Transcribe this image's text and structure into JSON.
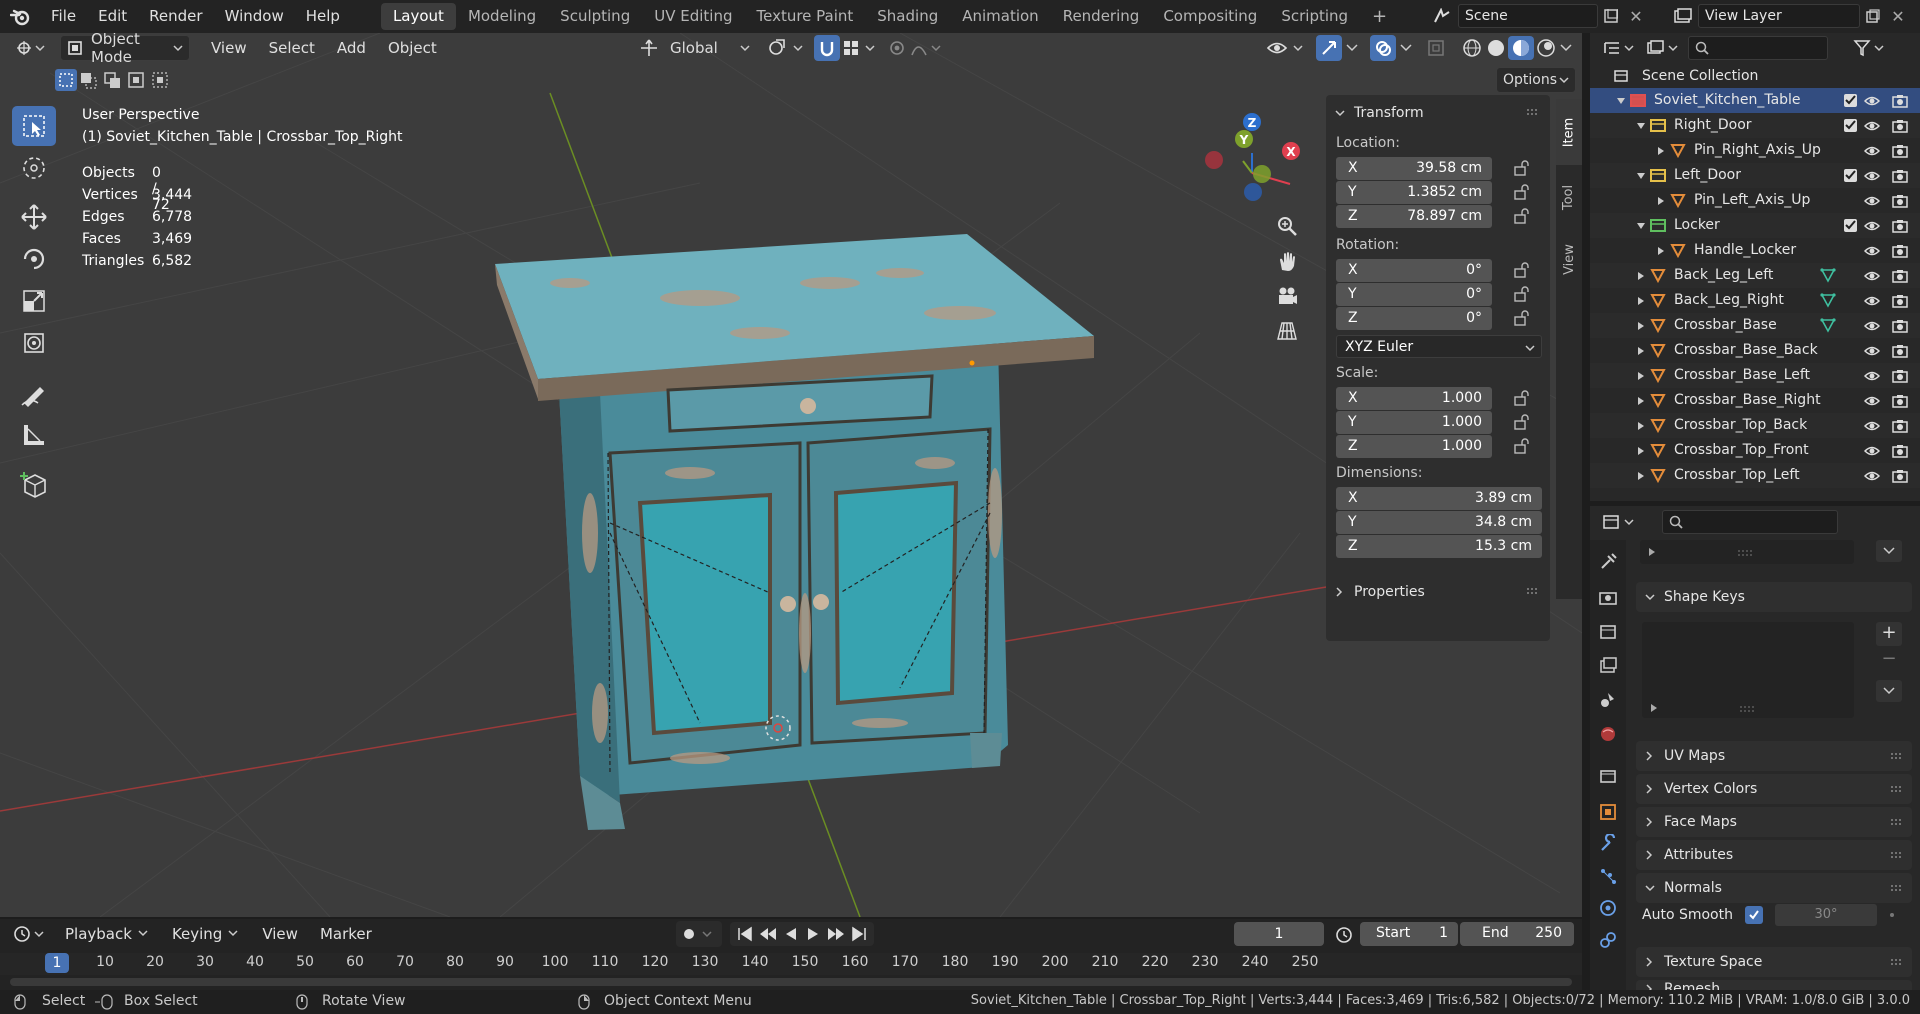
{
  "topbar": {
    "menus": [
      "File",
      "Edit",
      "Render",
      "Window",
      "Help"
    ],
    "workspaces": [
      "Layout",
      "Modeling",
      "Sculpting",
      "UV Editing",
      "Texture Paint",
      "Shading",
      "Animation",
      "Rendering",
      "Compositing",
      "Scripting"
    ],
    "add_tab": "+",
    "scene": "Scene",
    "view_layer": "View Layer"
  },
  "viewport": {
    "mode": "Object Mode",
    "menus": [
      "View",
      "Select",
      "Add",
      "Object"
    ],
    "transform_orientation": "Global",
    "options": "Options",
    "overlay_title": "User Perspective",
    "overlay_subtitle": "(1) Soviet_Kitchen_Table | Crossbar_Top_Right",
    "stats": [
      {
        "label": "Objects",
        "value": "0 / 72"
      },
      {
        "label": "Vertices",
        "value": "3,444"
      },
      {
        "label": "Edges",
        "value": "6,778"
      },
      {
        "label": "Faces",
        "value": "3,469"
      },
      {
        "label": "Triangles",
        "value": "6,582"
      }
    ],
    "gizmo": {
      "x": "X",
      "y": "Y",
      "z": "Z"
    },
    "side_tabs": [
      "Item",
      "Tool",
      "View"
    ]
  },
  "npanel": {
    "transform": "Transform",
    "location": "Location:",
    "loc": [
      {
        "ax": "X",
        "v": "39.58 cm"
      },
      {
        "ax": "Y",
        "v": "1.3852 cm"
      },
      {
        "ax": "Z",
        "v": "78.897 cm"
      }
    ],
    "rotation": "Rotation:",
    "rot": [
      {
        "ax": "X",
        "v": "0°"
      },
      {
        "ax": "Y",
        "v": "0°"
      },
      {
        "ax": "Z",
        "v": "0°"
      }
    ],
    "rot_mode": "XYZ Euler",
    "scale": "Scale:",
    "scl": [
      {
        "ax": "X",
        "v": "1.000"
      },
      {
        "ax": "Y",
        "v": "1.000"
      },
      {
        "ax": "Z",
        "v": "1.000"
      }
    ],
    "dimensions": "Dimensions:",
    "dim": [
      {
        "ax": "X",
        "v": "3.89 cm"
      },
      {
        "ax": "Y",
        "v": "34.8 cm"
      },
      {
        "ax": "Z",
        "v": "15.3 cm"
      }
    ],
    "properties": "Properties"
  },
  "outliner": {
    "root": "Scene Collection",
    "items": [
      {
        "name": "Soviet_Kitchen_Table",
        "indent": 0,
        "type": "collection",
        "selected": true
      },
      {
        "name": "Right_Door",
        "indent": 1,
        "type": "collection"
      },
      {
        "name": "Pin_Right_Axis_Up",
        "indent": 2,
        "type": "mesh"
      },
      {
        "name": "Left_Door",
        "indent": 1,
        "type": "collection"
      },
      {
        "name": "Pin_Left_Axis_Up",
        "indent": 2,
        "type": "mesh"
      },
      {
        "name": "Locker",
        "indent": 1,
        "type": "collection-green"
      },
      {
        "name": "Handle_Locker",
        "indent": 2,
        "type": "mesh"
      },
      {
        "name": "Back_Leg_Left",
        "indent": 1,
        "type": "mesh",
        "mod": true
      },
      {
        "name": "Back_Leg_Right",
        "indent": 1,
        "type": "mesh",
        "mod": true
      },
      {
        "name": "Crossbar_Base",
        "indent": 1,
        "type": "mesh",
        "mod": true
      },
      {
        "name": "Crossbar_Base_Back",
        "indent": 1,
        "type": "mesh"
      },
      {
        "name": "Crossbar_Base_Left",
        "indent": 1,
        "type": "mesh"
      },
      {
        "name": "Crossbar_Base_Right",
        "indent": 1,
        "type": "mesh"
      },
      {
        "name": "Crossbar_Top_Back",
        "indent": 1,
        "type": "mesh"
      },
      {
        "name": "Crossbar_Top_Front",
        "indent": 1,
        "type": "mesh"
      },
      {
        "name": "Crossbar_Top_Left",
        "indent": 1,
        "type": "mesh"
      }
    ]
  },
  "properties": {
    "sections": [
      "Shape Keys",
      "UV Maps",
      "Vertex Colors",
      "Face Maps",
      "Attributes",
      "Normals",
      "Texture Space",
      "Remesh"
    ],
    "auto_smooth": "Auto Smooth",
    "angle": "30°"
  },
  "timeline": {
    "menus": [
      "Playback",
      "Keying",
      "View",
      "Marker"
    ],
    "current_frame": "1",
    "start_label": "Start",
    "start": "1",
    "end_label": "End",
    "end": "250",
    "ticks": [
      "1",
      "10",
      "20",
      "30",
      "40",
      "50",
      "60",
      "70",
      "80",
      "90",
      "100",
      "110",
      "120",
      "130",
      "140",
      "150",
      "160",
      "170",
      "180",
      "190",
      "200",
      "210",
      "220",
      "230",
      "240",
      "250"
    ]
  },
  "statusbar": {
    "select": "Select",
    "box_select": "Box Select",
    "rotate_view": "Rotate View",
    "context_menu": "Object Context Menu",
    "info": "Soviet_Kitchen_Table | Crossbar_Top_Right | Verts:3,444 | Faces:3,469 | Tris:6,582 | Objects:0/72 | Memory: 110.2 MiB | VRAM: 1.0/8.0 GiB | 3.0.0"
  },
  "colors": {
    "accent": "#4772b3",
    "selected_row": "#334d80",
    "x_axis": "#e03f4f",
    "y_axis": "#7ea12c",
    "z_axis": "#2c6fce"
  }
}
